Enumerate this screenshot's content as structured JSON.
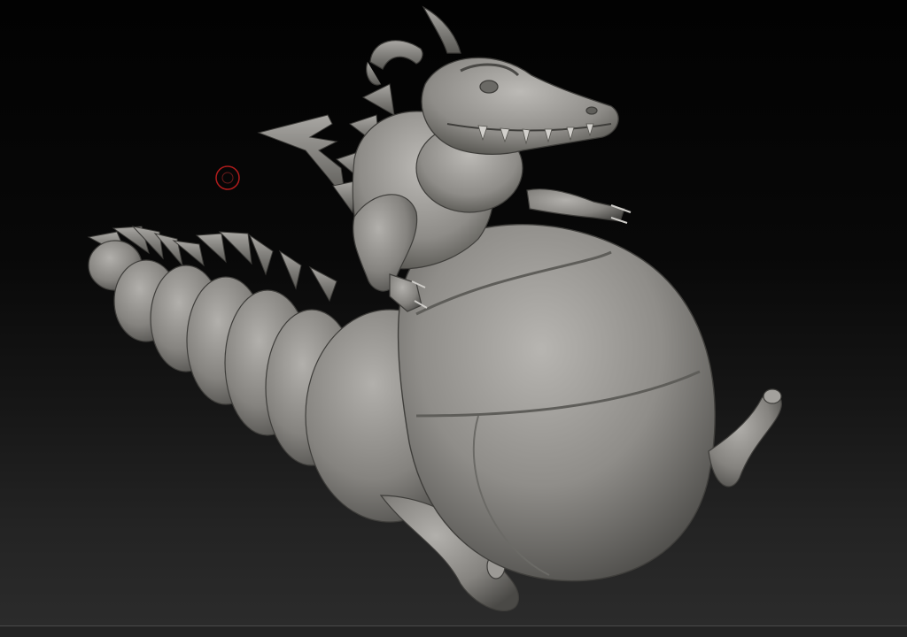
{
  "viewport": {
    "background_top": "#020202",
    "background_bottom": "#2c2c2c",
    "model_material_color": "#9a9894",
    "brush_cursor_color": "#b01c1c"
  },
  "model": {
    "icon": "sculpted-dragon-model"
  },
  "brush_cursor": {
    "icon": "brush-circle-icon"
  }
}
